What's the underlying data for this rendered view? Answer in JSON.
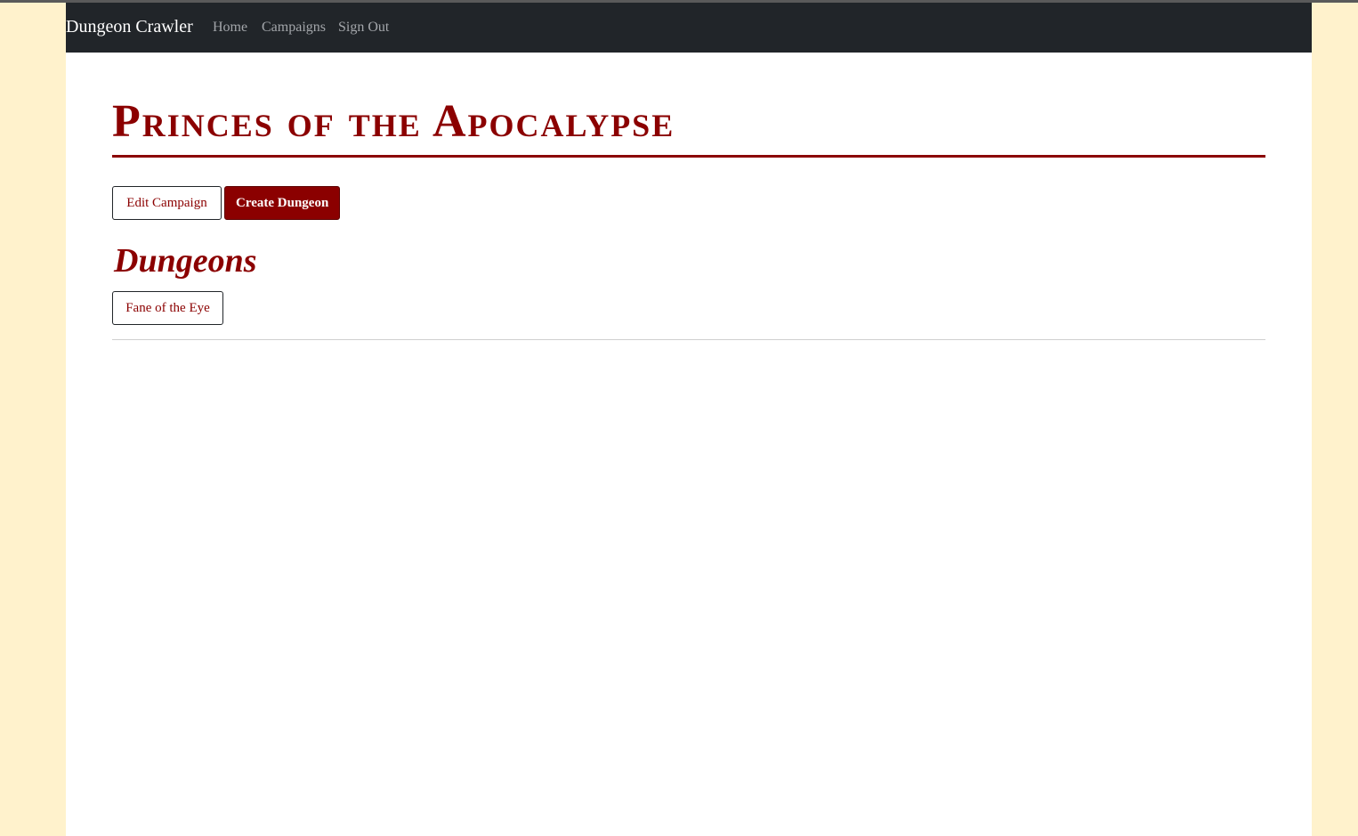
{
  "nav": {
    "brand": "Dungeon Crawler",
    "links": [
      "Home",
      "Campaigns",
      "Sign Out"
    ]
  },
  "campaign": {
    "title": "Princes of the Apocalypse",
    "edit_label": "Edit Campaign",
    "create_dungeon_label": "Create Dungeon"
  },
  "dungeons": {
    "heading": "Dungeons",
    "items": [
      "Fane of the Eye"
    ]
  },
  "colors": {
    "accent": "#8b0000",
    "navbar": "#212529",
    "page_background": "#fff2cc"
  }
}
